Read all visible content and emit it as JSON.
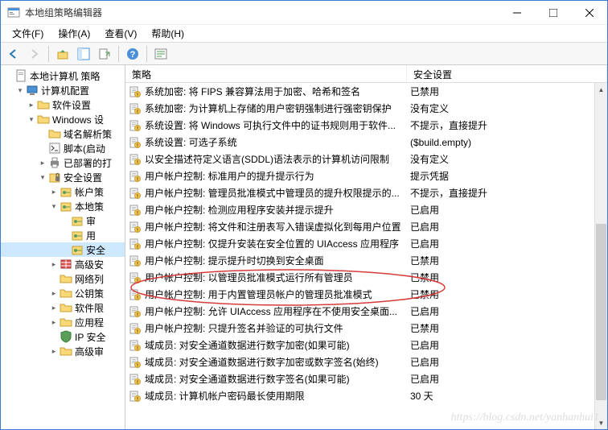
{
  "window": {
    "title": "本地组策略编辑器"
  },
  "menu": {
    "file": "文件(F)",
    "action": "操作(A)",
    "view": "查看(V)",
    "help": "帮助(H)"
  },
  "tree": [
    {
      "depth": 0,
      "expander": "",
      "label": "本地计算机 策略",
      "icon": "doc"
    },
    {
      "depth": 1,
      "expander": "▾",
      "label": "计算机配置",
      "icon": "computer"
    },
    {
      "depth": 2,
      "expander": "▸",
      "label": "软件设置",
      "icon": "folder"
    },
    {
      "depth": 2,
      "expander": "▾",
      "label": "Windows 设",
      "icon": "folder"
    },
    {
      "depth": 3,
      "expander": "",
      "label": "域名解析策",
      "icon": "folder"
    },
    {
      "depth": 3,
      "expander": "",
      "label": "脚本(启动",
      "icon": "script"
    },
    {
      "depth": 3,
      "expander": "▸",
      "label": "已部署的打",
      "icon": "printer"
    },
    {
      "depth": 3,
      "expander": "▾",
      "label": "安全设置",
      "icon": "lock"
    },
    {
      "depth": 4,
      "expander": "▸",
      "label": "帐户策",
      "icon": "key"
    },
    {
      "depth": 4,
      "expander": "▾",
      "label": "本地策",
      "icon": "key"
    },
    {
      "depth": 5,
      "expander": "",
      "label": "审",
      "icon": "key"
    },
    {
      "depth": 5,
      "expander": "",
      "label": "用",
      "icon": "key"
    },
    {
      "depth": 5,
      "expander": "",
      "label": "安全",
      "icon": "key",
      "selected": true
    },
    {
      "depth": 4,
      "expander": "▸",
      "label": "高级安",
      "icon": "firewall"
    },
    {
      "depth": 4,
      "expander": "",
      "label": "网络列",
      "icon": "folder"
    },
    {
      "depth": 4,
      "expander": "▸",
      "label": "公钥策",
      "icon": "folder"
    },
    {
      "depth": 4,
      "expander": "▸",
      "label": "软件限",
      "icon": "folder"
    },
    {
      "depth": 4,
      "expander": "▸",
      "label": "应用程",
      "icon": "folder"
    },
    {
      "depth": 4,
      "expander": "",
      "label": "IP 安全",
      "icon": "shield"
    },
    {
      "depth": 4,
      "expander": "▸",
      "label": "高级审",
      "icon": "folder"
    }
  ],
  "columns": {
    "policy": "策略",
    "setting": "安全设置"
  },
  "rows": [
    {
      "policy": "系统加密: 将 FIPS 兼容算法用于加密、哈希和签名",
      "setting": "已禁用"
    },
    {
      "policy": "系统加密: 为计算机上存储的用户密钥强制进行强密钥保护",
      "setting": "没有定义"
    },
    {
      "policy": "系统设置: 将 Windows 可执行文件中的证书规则用于软件...",
      "setting": "不提示，直接提升"
    },
    {
      "policy": "系统设置: 可选子系统",
      "setting": "($build.empty)"
    },
    {
      "policy": "以安全描述符定义语言(SDDL)语法表示的计算机访问限制",
      "setting": "没有定义"
    },
    {
      "policy": "用户帐户控制: 标准用户的提升提示行为",
      "setting": "提示凭据"
    },
    {
      "policy": "用户帐户控制: 管理员批准模式中管理员的提升权限提示的...",
      "setting": "不提示，直接提升"
    },
    {
      "policy": "用户帐户控制: 检测应用程序安装并提示提升",
      "setting": "已启用"
    },
    {
      "policy": "用户帐户控制: 将文件和注册表写入错误虚拟化到每用户位置",
      "setting": "已启用"
    },
    {
      "policy": "用户帐户控制: 仅提升安装在安全位置的 UIAccess 应用程序",
      "setting": "已启用"
    },
    {
      "policy": "用户帐户控制: 提示提升时切换到安全桌面",
      "setting": "已禁用"
    },
    {
      "policy": "用户帐户控制: 以管理员批准模式运行所有管理员",
      "setting": "已禁用",
      "hl": true
    },
    {
      "policy": "用户帐户控制: 用于内置管理员帐户的管理员批准模式",
      "setting": "已禁用",
      "hl": true
    },
    {
      "policy": "用户帐户控制: 允许 UIAccess 应用程序在不使用安全桌面...",
      "setting": "已启用"
    },
    {
      "policy": "用户帐户控制: 只提升签名并验证的可执行文件",
      "setting": "已禁用"
    },
    {
      "policy": "域成员: 对安全通道数据进行数字加密(如果可能)",
      "setting": "已启用"
    },
    {
      "policy": "域成员: 对安全通道数据进行数字加密或数字签名(始终)",
      "setting": "已启用"
    },
    {
      "policy": "域成员: 对安全通道数据进行数字签名(如果可能)",
      "setting": "已启用"
    },
    {
      "policy": "域成员: 计算机帐户密码最长使用期限",
      "setting": "30 天"
    }
  ],
  "watermark": "https://blog.csdn.net/yanhanhui1"
}
